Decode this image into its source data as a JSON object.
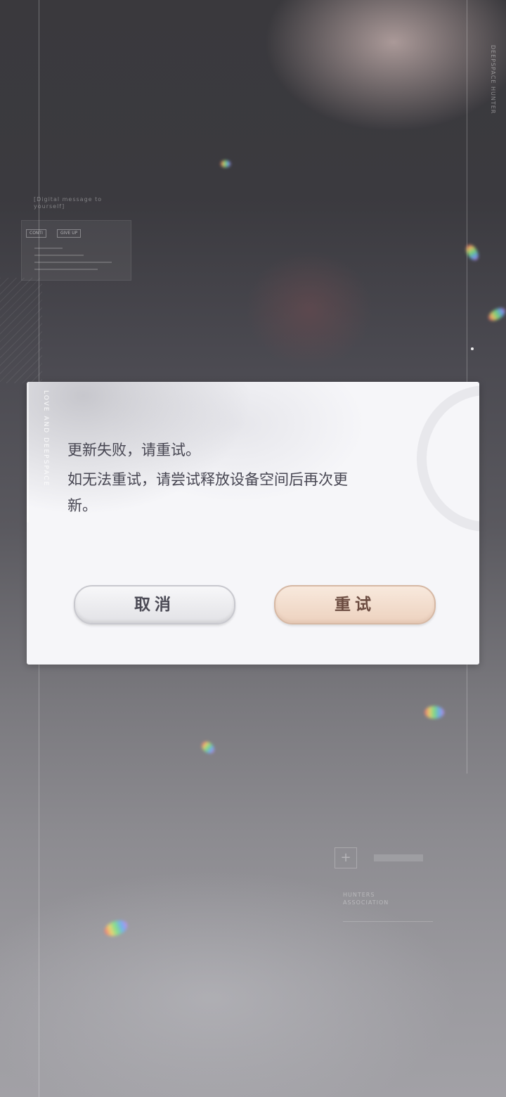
{
  "background": {
    "brand_vertical": "DEEPSPACE HUNTER",
    "message_note": "[Digital message to yourself]",
    "mini_panel": {
      "button_continue": "CONTI",
      "button_give_up": "GIVE UP"
    },
    "association_label": "HUNTERS ASSOCIATION",
    "icons": [
      "sparkle-icon",
      "plus-icon"
    ]
  },
  "dialog": {
    "side_text": "LOVE AND DEEPSPACE",
    "message_line1": "更新失败，请重试。",
    "message_line2": "如无法重试，请尝试释放设备空间后再次更",
    "message_line3": "新。",
    "cancel_label": "取消",
    "retry_label": "重试",
    "colors": {
      "dialog_bg": "#f6f6f9",
      "text": "#474652",
      "retry_accent": "#edd2bf",
      "cancel_accent": "#e2e2e6"
    }
  }
}
